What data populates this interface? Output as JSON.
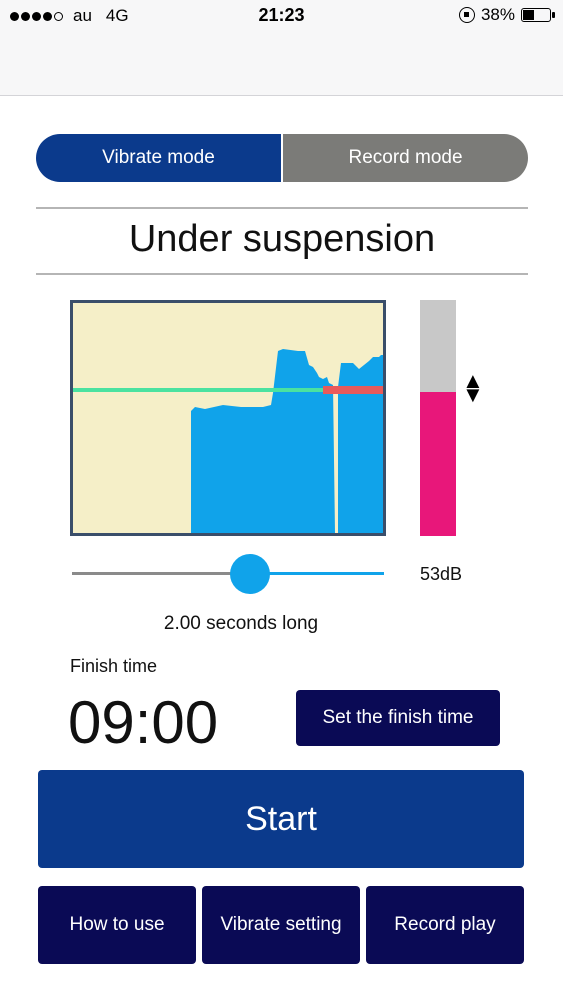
{
  "status_bar": {
    "carrier": "au",
    "network": "4G",
    "time": "21:23",
    "battery": "38%",
    "battery_level": 0.38
  },
  "modes": {
    "vibrate": "Vibrate mode",
    "record": "Record mode",
    "active": "vibrate"
  },
  "state_title": "Under suspension",
  "monitor": {
    "level_db": "53dB",
    "meter_level_fraction": 0.61,
    "colors": {
      "background": "#f5efc8",
      "signal": "#10a3ea",
      "threshold_line": "#4ae2a0",
      "threshold_exceeded": "#e85a5a",
      "meter_fill": "#e8177a",
      "meter_empty": "#c8c8c8"
    }
  },
  "duration": {
    "label": "2.00 seconds long",
    "slider_fraction": 0.57
  },
  "finish": {
    "label": "Finish time",
    "time": "09:00",
    "set_button": "Set the finish time"
  },
  "start_button": "Start",
  "bottom_buttons": {
    "how_to_use": "How to use",
    "vibrate_setting": "Vibrate setting",
    "record_play": "Record play"
  },
  "colors": {
    "primary": "#0b3a8c",
    "dark_button": "#0a0a55",
    "inactive_mode": "#7b7b78"
  }
}
